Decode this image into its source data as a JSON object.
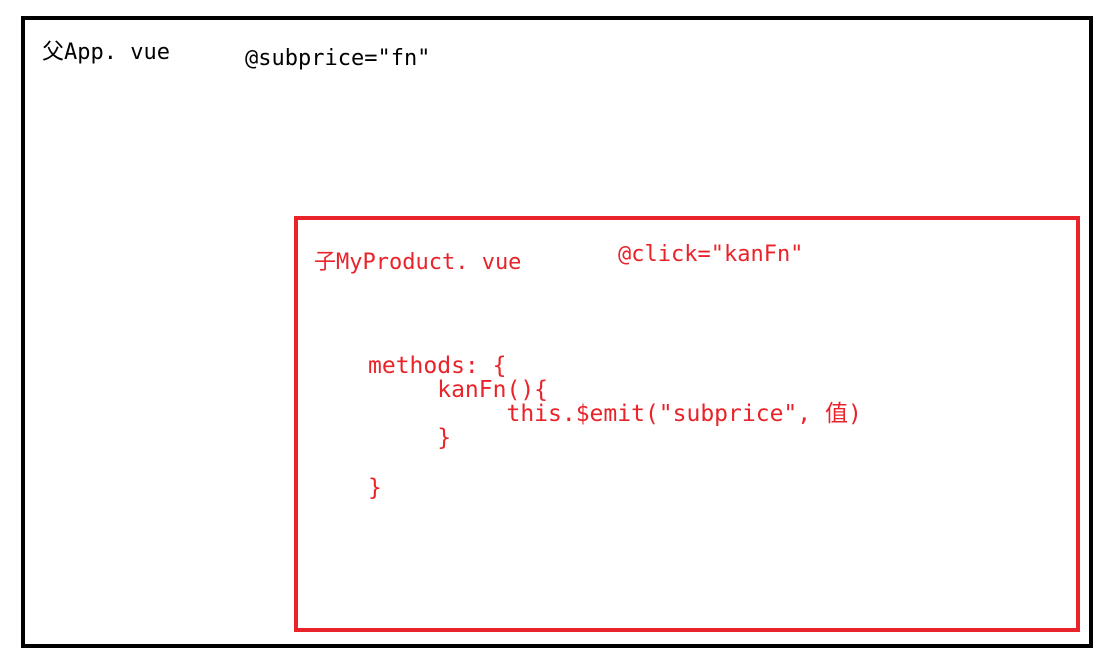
{
  "colors": {
    "parent_border": "#000000",
    "child_border": "#e8232a",
    "child_text": "#e8232a"
  },
  "parent": {
    "title": "父App. vue",
    "event_binding": "@subprice=\"fn\""
  },
  "child": {
    "title": "子MyProduct. vue",
    "event_binding": "@click=\"kanFn\"",
    "code_lines": [
      "methods: {",
      "     kanFn(){",
      "          this.$emit(\"subprice\", 值)",
      "     }",
      "}"
    ]
  }
}
